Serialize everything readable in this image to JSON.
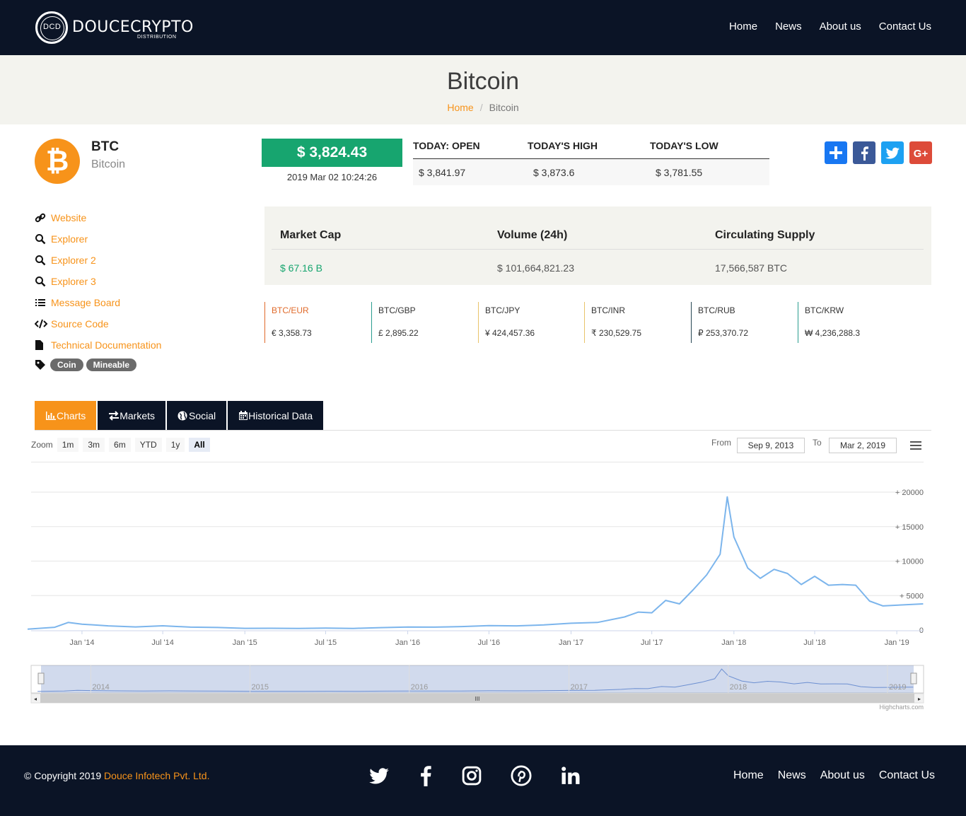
{
  "brand": {
    "mark": "DCD",
    "name": "DOUCECRYPTO",
    "tagline": "DISTRIBUTION"
  },
  "nav": [
    "Home",
    "News",
    "About us",
    "Contact Us"
  ],
  "page": {
    "title": "Bitcoin",
    "breadcrumb": [
      "Home",
      "Bitcoin"
    ]
  },
  "coin": {
    "logo_glyph": "₿",
    "symbol": "BTC",
    "name": "Bitcoin"
  },
  "price": {
    "value": "$ 3,824.43",
    "time": "2019 Mar 02 10:24:26"
  },
  "today": {
    "headers": [
      "TODAY: OPEN",
      "TODAY'S HIGH",
      "TODAY'S LOW"
    ],
    "values": [
      "$ 3,841.97",
      "$ 3,873.6",
      "$ 3,781.55"
    ]
  },
  "share": [
    {
      "icon": "plus-share-icon",
      "glyph": "+",
      "color": "#1877f2"
    },
    {
      "icon": "facebook-icon",
      "glyph": "f",
      "color": "#3b5998"
    },
    {
      "icon": "twitter-icon",
      "glyph": "t",
      "color": "#1da1f2"
    },
    {
      "icon": "google-plus-icon",
      "glyph": "G+",
      "color": "#dd4b39"
    }
  ],
  "links": [
    {
      "icon": "link-icon",
      "label": "Website"
    },
    {
      "icon": "search-icon",
      "label": "Explorer"
    },
    {
      "icon": "search-icon",
      "label": "Explorer 2"
    },
    {
      "icon": "search-icon",
      "label": "Explorer 3"
    },
    {
      "icon": "list-icon",
      "label": "Message Board"
    },
    {
      "icon": "code-icon",
      "label": "Source Code"
    },
    {
      "icon": "file-icon",
      "label": "Technical Documentation"
    }
  ],
  "tags": [
    "Coin",
    "Mineable"
  ],
  "market": {
    "headers": [
      "Market Cap",
      "Volume (24h)",
      "Circulating Supply"
    ],
    "values": [
      "$ 67.16 B",
      "$ 101,664,821.23",
      "17,566,587 BTC"
    ]
  },
  "pairs": [
    {
      "name": "BTC/EUR",
      "value": "€ 3,358.73",
      "color": "#e06a2a"
    },
    {
      "name": "BTC/GBP",
      "value": "£ 2,895.22",
      "color": "#2a9d8f"
    },
    {
      "name": "BTC/JPY",
      "value": "¥ 424,457.36",
      "color": "#e9c46a"
    },
    {
      "name": "BTC/INR",
      "value": "₹ 230,529.75",
      "color": "#e9c46a"
    },
    {
      "name": "BTC/RUB",
      "value": "₽ 253,370.72",
      "color": "#264653"
    },
    {
      "name": "BTC/KRW",
      "value": "₩ 4,236,288.3",
      "color": "#2a9d8f"
    }
  ],
  "tabs": [
    {
      "label": "Charts",
      "icon": "bar-chart-icon",
      "active": true
    },
    {
      "label": "Markets",
      "icon": "exchange-icon",
      "active": false
    },
    {
      "label": "Social",
      "icon": "globe-icon",
      "active": false
    },
    {
      "label": "Historical Data",
      "icon": "calendar-icon",
      "active": false
    }
  ],
  "zoom": {
    "label": "Zoom",
    "buttons": [
      "1m",
      "3m",
      "6m",
      "YTD",
      "1y",
      "All"
    ],
    "selected": "All"
  },
  "range": {
    "from_label": "From",
    "from": "Sep 9, 2013",
    "to_label": "To",
    "to": "Mar 2, 2019"
  },
  "chart_data": {
    "type": "line",
    "title": "",
    "xlabel": "",
    "ylabel": "",
    "series": [
      {
        "values": []
      }
    ],
    "x": [
      "2013-09",
      "2013-11",
      "2013-12",
      "2014-01",
      "2014-03",
      "2014-05",
      "2014-07",
      "2014-09",
      "2014-11",
      "2015-01",
      "2015-03",
      "2015-05",
      "2015-07",
      "2015-09",
      "2015-11",
      "2016-01",
      "2016-03",
      "2016-05",
      "2016-07",
      "2016-09",
      "2016-11",
      "2017-01",
      "2017-03",
      "2017-05",
      "2017-06",
      "2017-07",
      "2017-08",
      "2017-09",
      "2017-10",
      "2017-11",
      "2017-12-01",
      "2017-12-17",
      "2018-01",
      "2018-02",
      "2018-03",
      "2018-04",
      "2018-05",
      "2018-06",
      "2018-07",
      "2018-08",
      "2018-09",
      "2018-10",
      "2018-11",
      "2018-12",
      "2019-01",
      "2019-03"
    ],
    "y": [
      130,
      400,
      1100,
      850,
      600,
      450,
      620,
      420,
      370,
      250,
      260,
      240,
      280,
      240,
      350,
      430,
      420,
      500,
      650,
      600,
      740,
      980,
      1100,
      1900,
      2600,
      2500,
      4300,
      3800,
      5800,
      8000,
      11000,
      19300,
      13500,
      9000,
      7500,
      8800,
      8200,
      6600,
      7800,
      6500,
      6600,
      6500,
      4200,
      3500,
      3600,
      3800
    ],
    "y_ticks": [
      "0",
      "5000",
      "10000",
      "15000",
      "20000"
    ],
    "x_ticks": [
      "Jan '14",
      "Jul '14",
      "Jan '15",
      "Jul '15",
      "Jan '16",
      "Jul '16",
      "Jan '17",
      "Jul '17",
      "Jan '18",
      "Jul '18",
      "Jan '19"
    ],
    "navigator_ticks": [
      "2014",
      "2015",
      "2016",
      "2017",
      "2018",
      "2019"
    ],
    "ylim": [
      0,
      20000
    ],
    "color": "#7cb5ec",
    "grid": true
  },
  "credits": "Highcharts.com",
  "footer": {
    "copyright": "© Copyright 2019",
    "company": "Douce Infotech Pvt. Ltd.",
    "social": [
      "twitter-icon",
      "facebook-icon",
      "instagram-icon",
      "pinterest-icon",
      "linkedin-icon"
    ],
    "links": [
      "Home",
      "News",
      "About us",
      "Contact Us"
    ]
  }
}
